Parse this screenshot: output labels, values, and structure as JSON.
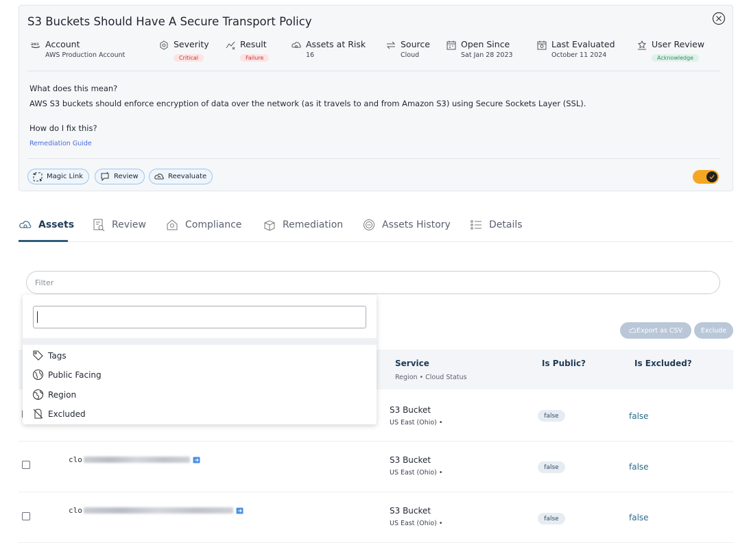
{
  "card": {
    "title": "S3 Buckets Should Have A Secure Transport Policy",
    "meta": [
      {
        "label": "Account",
        "value": "AWS Production Account",
        "icon": "aws-icon"
      },
      {
        "label": "Severity",
        "value": "Critical",
        "icon": "severity-icon"
      },
      {
        "label": "Result",
        "value": "Failure",
        "icon": "result-icon"
      },
      {
        "label": "Assets at Risk",
        "value": "16",
        "icon": "cloud-icon"
      },
      {
        "label": "Source",
        "value": "Cloud",
        "icon": "source-icon"
      },
      {
        "label": "Open Since",
        "value": "Sat Jan 28 2023",
        "icon": "calendar-icon"
      },
      {
        "label": "Last Evaluated",
        "value": "October 11 2024",
        "icon": "calendar-search-icon"
      },
      {
        "label": "User Review",
        "value": "Acknowledge",
        "icon": "user-review-icon"
      }
    ],
    "question1": "What does this mean?",
    "answer1": "AWS S3 buckets should enforce encryption of data over the network (as it travels to and from Amazon S3) using Secure Sockets Layer (SSL).",
    "question2": "How do I fix this?",
    "remediation_link": "Remediation Guide",
    "actions": {
      "magic_link": "Magic Link",
      "review": "Review",
      "reevaluate": "Reevaluate"
    },
    "toggle_on": true
  },
  "tabs": [
    {
      "label": "Assets",
      "active": true
    },
    {
      "label": "Review"
    },
    {
      "label": "Compliance"
    },
    {
      "label": "Remediation"
    },
    {
      "label": "Assets History"
    },
    {
      "label": "Details"
    }
  ],
  "filter": {
    "placeholder": "Filter"
  },
  "dropdown": {
    "search_value": "",
    "items": [
      "Tags",
      "Public Facing",
      "Region",
      "Excluded"
    ]
  },
  "toolbar": {
    "export_label": "Export as CSV",
    "exclude_label": "Exclude"
  },
  "table": {
    "headers": {
      "service": "Service",
      "service_sub": "Region • Cloud Status",
      "is_public": "Is Public?",
      "is_excluded": "Is Excluded?"
    },
    "rows": [
      {
        "name_prefix": "",
        "service": "S3 Bucket",
        "region": "US East (Ohio) •",
        "is_public": "false",
        "is_excluded": "false"
      },
      {
        "name_prefix": "clo",
        "service": "S3 Bucket",
        "region": "US East (Ohio) •",
        "is_public": "false",
        "is_excluded": "false"
      },
      {
        "name_prefix": "clo",
        "service": "S3 Bucket",
        "region": "US East (Ohio) •",
        "is_public": "false",
        "is_excluded": "false"
      }
    ]
  },
  "colors": {
    "accent": "#f5a623",
    "link": "#4a6cd8",
    "critical": "#c23838",
    "tab_active": "#2f5a7a"
  }
}
